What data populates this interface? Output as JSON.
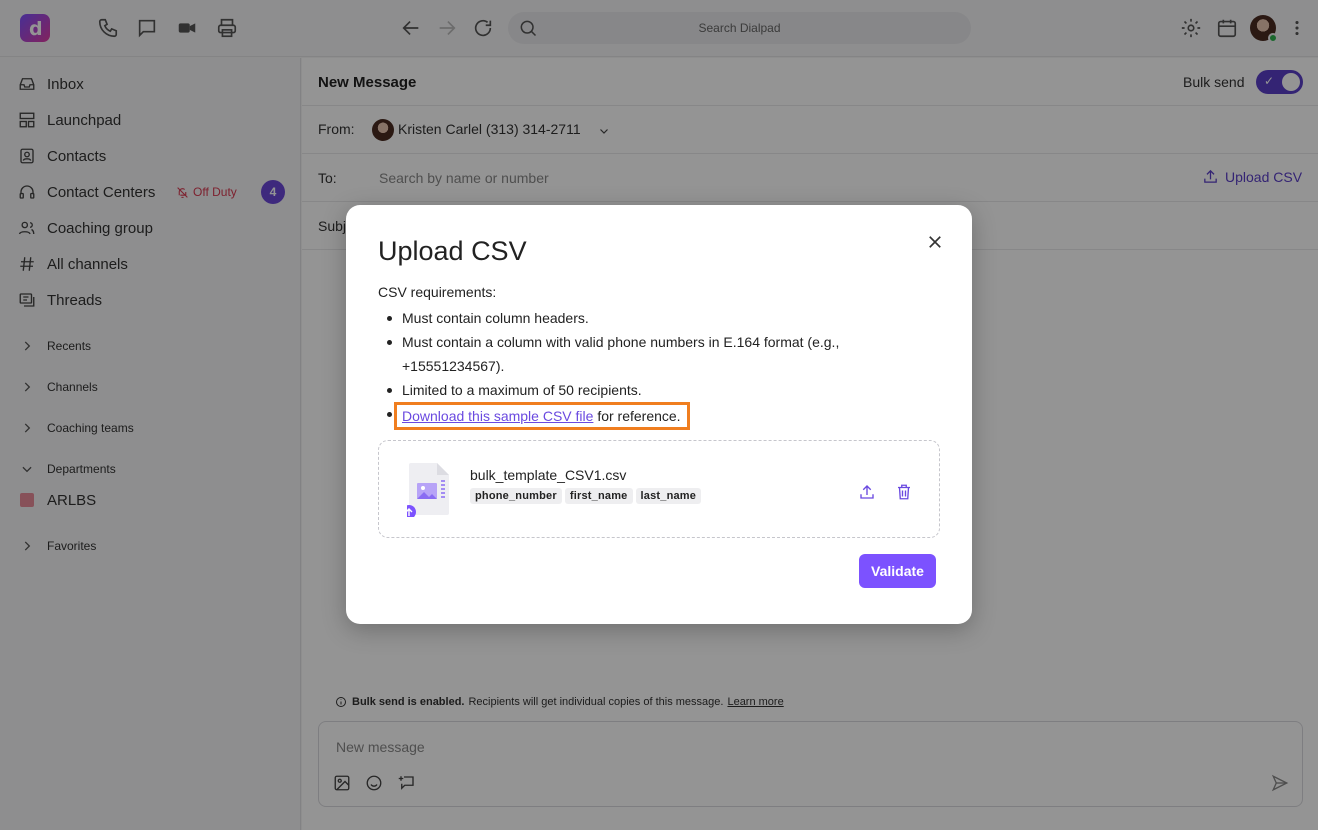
{
  "topbar": {
    "logo_letter": "d",
    "search_placeholder": "Search Dialpad"
  },
  "sidebar": {
    "items": [
      {
        "label": "Inbox",
        "icon": "inbox-icon"
      },
      {
        "label": "Launchpad",
        "icon": "launchpad-icon"
      },
      {
        "label": "Contacts",
        "icon": "contacts-icon"
      },
      {
        "label": "Contact Centers",
        "icon": "headset-icon"
      },
      {
        "label": "Coaching group",
        "icon": "users-icon"
      },
      {
        "label": "All channels",
        "icon": "hash-icon"
      },
      {
        "label": "Threads",
        "icon": "threads-icon"
      }
    ],
    "off_duty_label": "Off Duty",
    "contact_centers_badge": "4",
    "groups": [
      {
        "label": "Recents",
        "expanded": false
      },
      {
        "label": "Channels",
        "expanded": false
      },
      {
        "label": "Coaching teams",
        "expanded": false
      },
      {
        "label": "Departments",
        "expanded": true
      },
      {
        "label": "Favorites",
        "expanded": false
      }
    ],
    "department": {
      "label": "ARLBS",
      "color": "#e98c9a"
    }
  },
  "main": {
    "title": "New Message",
    "bulk_send_label": "Bulk send",
    "bulk_send_on": true,
    "from_label": "From:",
    "from_value": "Kristen Carlel (313) 314-2711",
    "to_label": "To:",
    "to_placeholder": "Search by name or number",
    "upload_csv_label": "Upload CSV",
    "subject_label": "Subj",
    "bulk_note_bold": "Bulk send is enabled.",
    "bulk_note_text": "Recipients will get individual copies of this message.",
    "bulk_note_link": "Learn more",
    "composer_placeholder": "New message"
  },
  "modal": {
    "title": "Upload CSV",
    "requirements_title": "CSV requirements:",
    "requirements": [
      "Must contain column headers.",
      "Must contain a column with valid phone numbers in E.164 format (e.g., +15551234567).",
      "Limited to a maximum of 50 recipients."
    ],
    "download_link": "Download this sample CSV file",
    "download_suffix": "for reference.",
    "file_name": "bulk_template_CSV1.csv",
    "columns": [
      "phone_number",
      "first_name",
      "last_name"
    ],
    "validate_label": "Validate"
  },
  "colors": {
    "accent": "#7c52ff",
    "link": "#6a49e0",
    "highlight": "#f07e1f",
    "off_duty": "#d83a52"
  }
}
